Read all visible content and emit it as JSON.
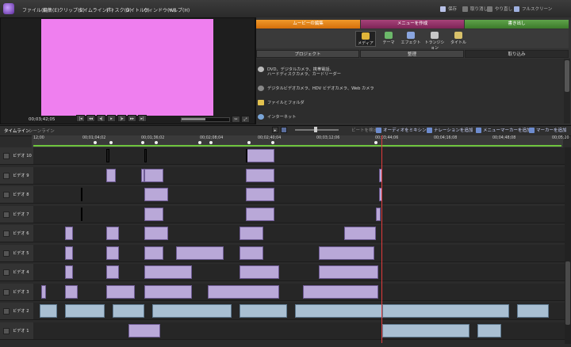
{
  "menubar": {
    "items": [
      "ファイル(F)",
      "編集(E)",
      "クリップ(C)",
      "タイムライン(T)",
      "ディスク(D)",
      "タイトル(I)",
      "ウィンドウ(W)",
      "ヘルプ(H)"
    ],
    "save": "保存",
    "undo": "取り消し",
    "redo": "やり直し",
    "fullscreen": "フルスクリーン"
  },
  "preview": {
    "timecode": "00;03;42;05",
    "screen_color": "#ef7fef"
  },
  "mode_tabs": [
    {
      "label": "ムービーの編集",
      "color": "#e8861a"
    },
    {
      "label": "メニューを作成",
      "color": "#8e2f66"
    },
    {
      "label": "書き出し",
      "color": "#4c8f3a"
    }
  ],
  "tools": [
    {
      "label": "メディア",
      "icon": "media-icon"
    },
    {
      "label": "テーマ",
      "icon": "theme-icon"
    },
    {
      "label": "エフェクト",
      "icon": "fx-icon"
    },
    {
      "label": "トランジション",
      "icon": "transition-icon"
    },
    {
      "label": "タイトル",
      "icon": "title-icon"
    }
  ],
  "subtabs": [
    "プロジェクト",
    "整理",
    "取り込み"
  ],
  "media_sources": [
    {
      "line1": "DVD、デジタルカメラ、携帯電話、",
      "line2": "ハードディスクカメラ、カードリーダー"
    },
    {
      "line1": "デジタルビデオカメラ、HDV ビデオカメラ、Web カメラ",
      "line2": ""
    },
    {
      "line1": "ファイルとフォルダ",
      "line2": ""
    },
    {
      "line1": "インターネット",
      "line2": ""
    }
  ],
  "timeline": {
    "tabs": [
      "タイムライン",
      "シーンライン"
    ],
    "buttons": [
      "ビートを検出",
      "オーディオをミキシング",
      "ナレーションを追加",
      "メニューマーカーを追加",
      "マーカーを追加"
    ],
    "ruler": [
      "12;00",
      "00;01;04;02",
      "00;01;36;02",
      "00;02;08;04",
      "00;02;40;04",
      "00;03;12;06",
      "00;03;44;06",
      "00;04;16;08",
      "00;04;48;08",
      "00;05;20"
    ],
    "tracks": [
      "ビデオ 10",
      "ビデオ 9",
      "ビデオ 8",
      "ビデオ 7",
      "ビデオ 6",
      "ビデオ 5",
      "ビデオ 4",
      "ビデオ 3",
      "ビデオ 2",
      "ビデオ 1"
    ]
  }
}
